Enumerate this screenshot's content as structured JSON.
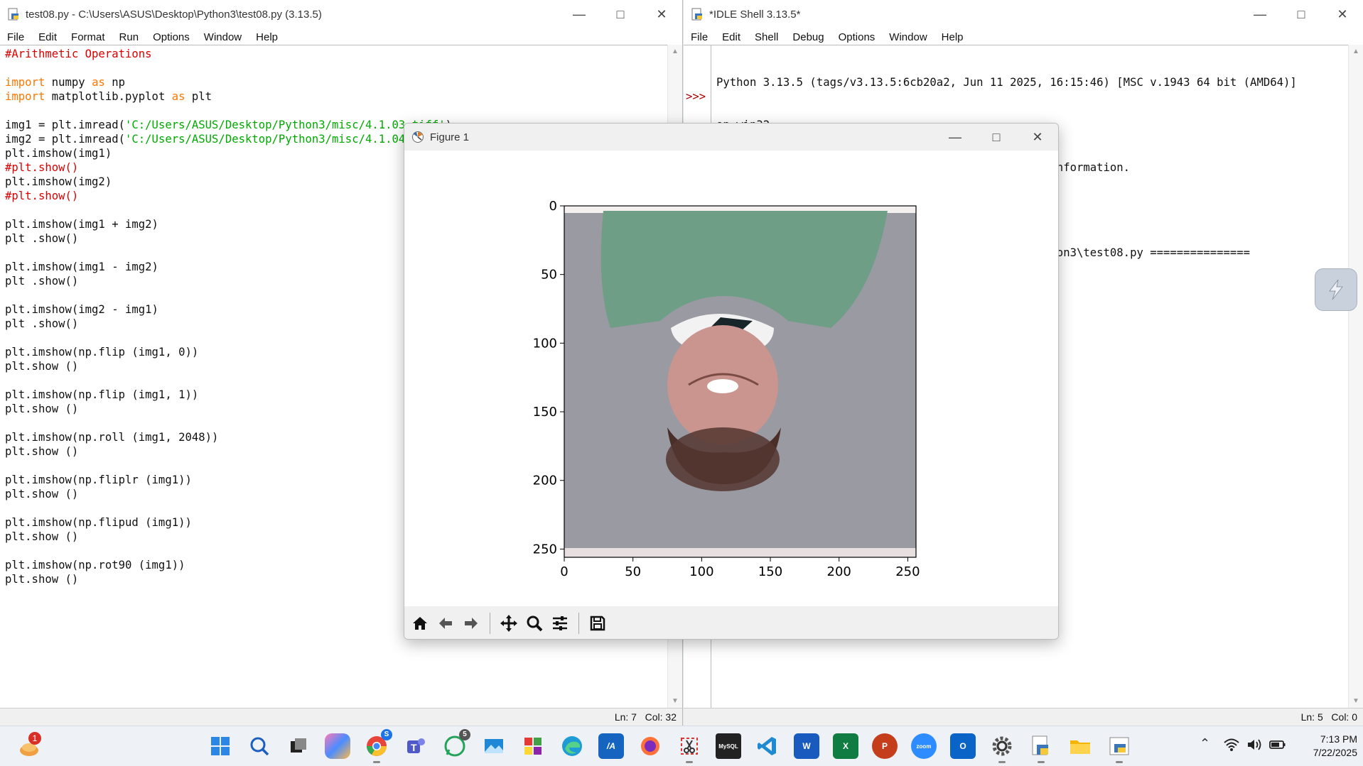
{
  "editor": {
    "title": "test08.py - C:\\Users\\ASUS\\Desktop\\Python3\\test08.py (3.13.5)",
    "menu": [
      "File",
      "Edit",
      "Format",
      "Run",
      "Options",
      "Window",
      "Help"
    ],
    "status": "Ln: 7   Col: 32",
    "lines": [
      [
        {
          "t": "#Arithmetic Operations",
          "c": "cm"
        }
      ],
      [],
      [
        {
          "t": "import",
          "c": "kw"
        },
        {
          "t": " numpy "
        },
        {
          "t": "as",
          "c": "kw"
        },
        {
          "t": " np"
        }
      ],
      [
        {
          "t": "import",
          "c": "kw"
        },
        {
          "t": " matplotlib.pyplot "
        },
        {
          "t": "as",
          "c": "kw"
        },
        {
          "t": " plt"
        }
      ],
      [],
      [
        {
          "t": "img1 = plt.imread("
        },
        {
          "t": "'C:/Users/ASUS/Desktop/Python3/misc/4.1.03.tiff'",
          "c": "st"
        },
        {
          "t": ")"
        }
      ],
      [
        {
          "t": "img2 = plt.imread("
        },
        {
          "t": "'C:/Users/ASUS/Desktop/Python3/misc/4.1.04.tiff'",
          "c": "st"
        },
        {
          "t": ")"
        }
      ],
      [
        {
          "t": "plt.imshow(img1)"
        }
      ],
      [
        {
          "t": "#plt.show()",
          "c": "cm"
        }
      ],
      [
        {
          "t": "plt.imshow(img2)"
        }
      ],
      [
        {
          "t": "#plt.show()",
          "c": "cm"
        }
      ],
      [],
      [
        {
          "t": "plt.imshow(img1 + img2)"
        }
      ],
      [
        {
          "t": "plt .show()"
        }
      ],
      [],
      [
        {
          "t": "plt.imshow(img1 - img2)"
        }
      ],
      [
        {
          "t": "plt .show()"
        }
      ],
      [],
      [
        {
          "t": "plt.imshow(img2 - img1)"
        }
      ],
      [
        {
          "t": "plt .show()"
        }
      ],
      [],
      [
        {
          "t": "plt.imshow(np.flip (img1, 0))"
        }
      ],
      [
        {
          "t": "plt.show ()"
        }
      ],
      [],
      [
        {
          "t": "plt.imshow(np.flip (img1, 1))"
        }
      ],
      [
        {
          "t": "plt.show ()"
        }
      ],
      [],
      [
        {
          "t": "plt.imshow(np.roll (img1, 2048))"
        }
      ],
      [
        {
          "t": "plt.show ()"
        }
      ],
      [],
      [
        {
          "t": "plt.imshow(np.fliplr (img1))"
        }
      ],
      [
        {
          "t": "plt.show ()"
        }
      ],
      [],
      [
        {
          "t": "plt.imshow(np.flipud (img1))"
        }
      ],
      [
        {
          "t": "plt.show ()"
        }
      ],
      [],
      [
        {
          "t": "plt.imshow(np.rot90 (img1))"
        }
      ],
      [
        {
          "t": "plt.show ()"
        }
      ]
    ]
  },
  "shell": {
    "title": "*IDLE Shell 3.13.5*",
    "menu": [
      "File",
      "Edit",
      "Shell",
      "Debug",
      "Options",
      "Window",
      "Help"
    ],
    "prompt": ">>>",
    "lines": [
      "Python 3.13.5 (tags/v3.13.5:6cb20a2, Jun 11 2025, 16:15:46) [MSC v.1943 64 bit (AMD64)]",
      "on win32",
      "Enter \"help\" below or click \"Help\" above for more information.",
      "",
      "=============== RESTART: C:\\Users\\ASUS\\Desktop\\Python3\\test08.py ==============="
    ],
    "status": "Ln: 5   Col: 0"
  },
  "figure": {
    "title": "Figure 1",
    "chart_data": {
      "type": "image",
      "x_ticks": [
        "0",
        "50",
        "100",
        "150",
        "200",
        "250"
      ],
      "y_ticks": [
        "0",
        "50",
        "100",
        "150",
        "200",
        "250"
      ],
      "xlim": [
        0,
        256
      ],
      "ylim": [
        256,
        0
      ],
      "content": "upside-down portrait"
    },
    "toolbar": [
      "home-icon",
      "back-icon",
      "forward-icon",
      "pan-icon",
      "zoom-icon",
      "configure-icon",
      "save-icon"
    ]
  },
  "taskbar": {
    "notification_count": "1",
    "chrome_badge": "S",
    "whatsapp_badge": "5",
    "time": "7:13 PM",
    "date": "7/22/2025"
  },
  "colors": {
    "keyword": "#ff7700",
    "comment": "#dd0000",
    "string": "#00aa00",
    "prompt": "#aa0000"
  }
}
